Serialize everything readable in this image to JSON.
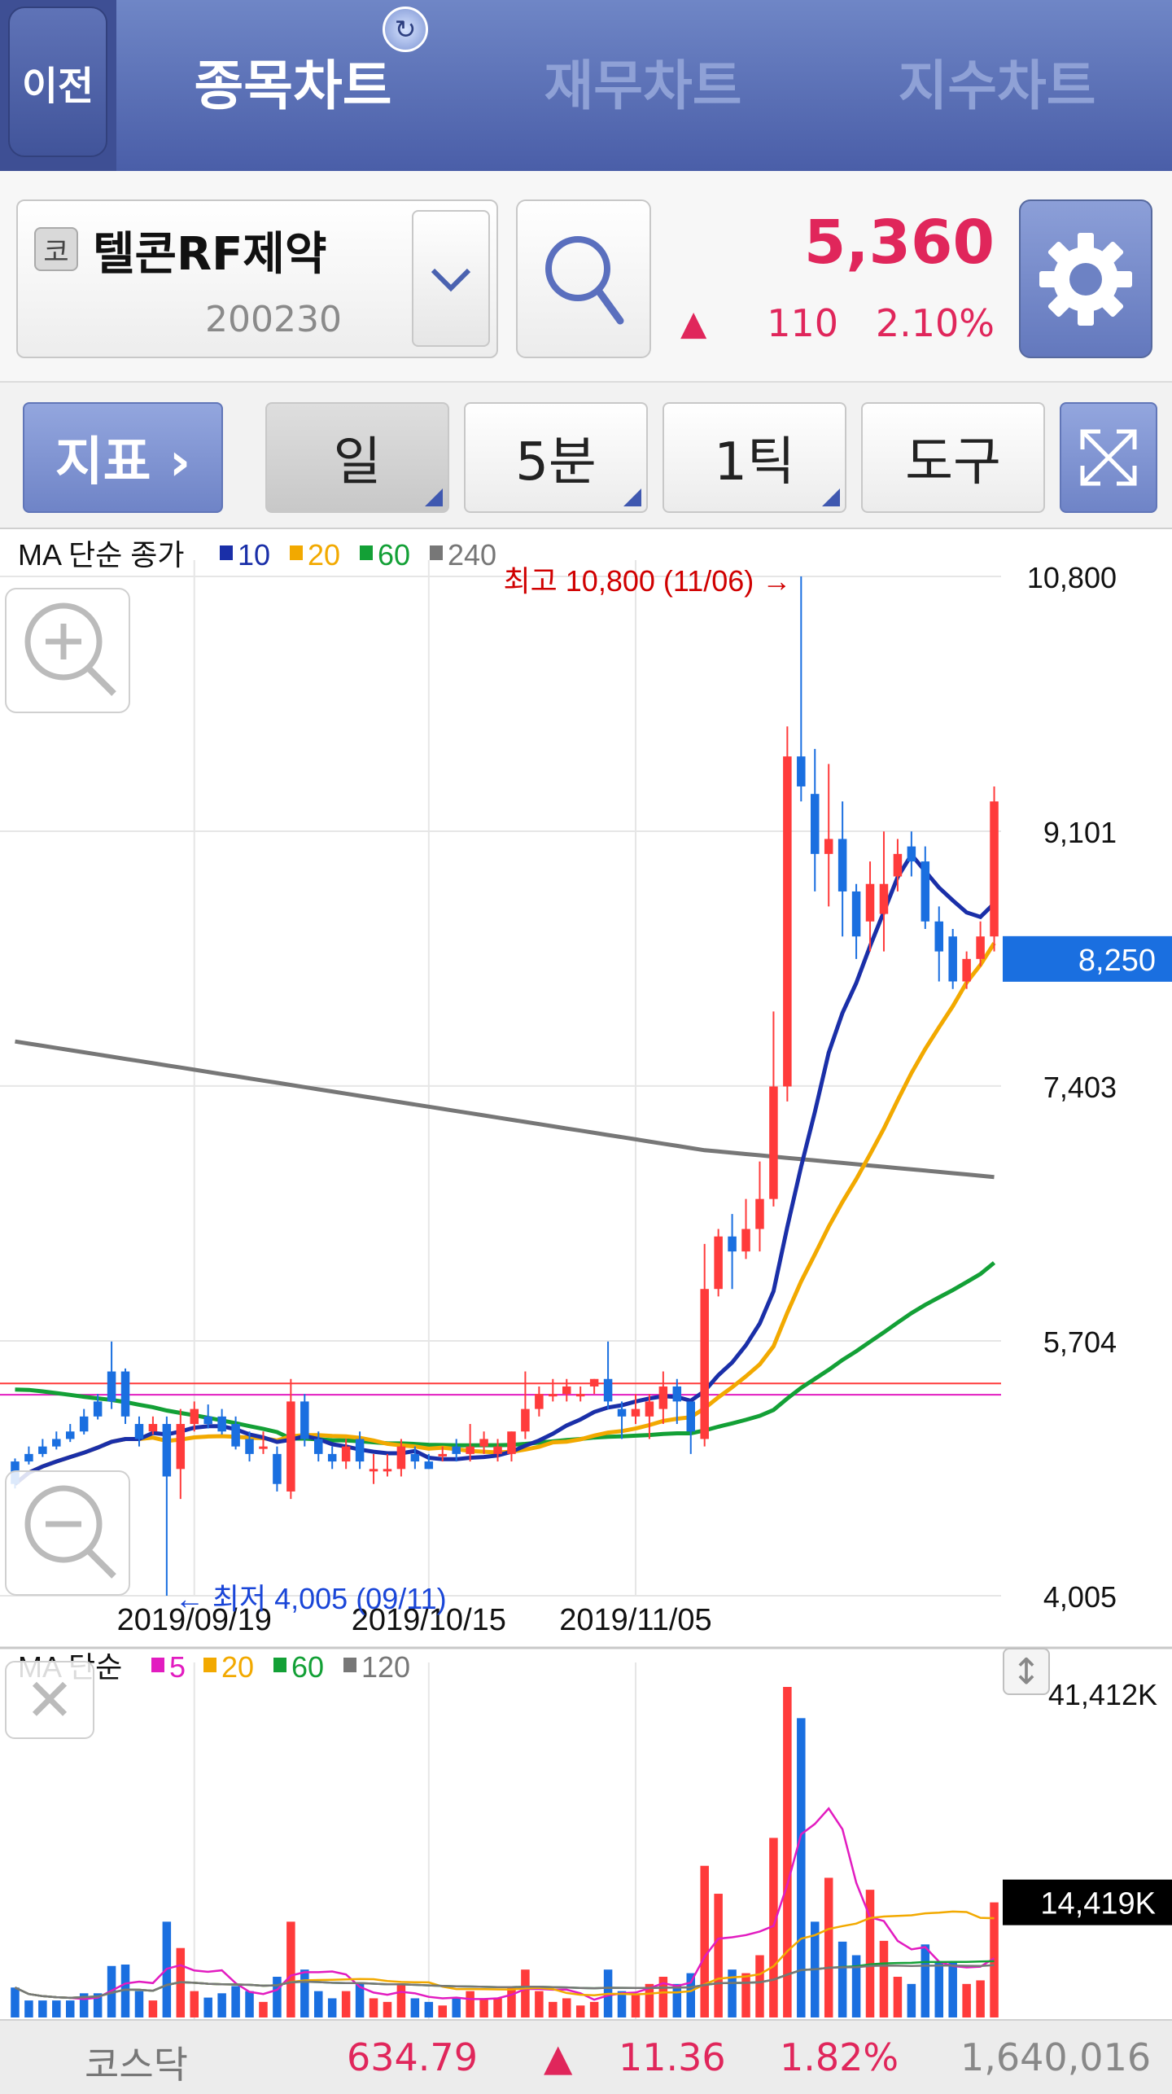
{
  "header": {
    "back_label": "이전",
    "tabs": [
      {
        "label": "종목차트",
        "active": true
      },
      {
        "label": "재무차트",
        "active": false
      },
      {
        "label": "지수차트",
        "active": false
      }
    ]
  },
  "stock": {
    "market_badge": "코",
    "name": "텔콘RF제약",
    "code": "200230",
    "price": "5,360",
    "change_arrow": "▲",
    "change": "110",
    "change_pct": "2.10%"
  },
  "toolbar": {
    "indicator_label": "지표  ›",
    "period_day": "일",
    "period_min": "5분",
    "period_tick": "1틱",
    "tools": "도구"
  },
  "colors": {
    "up": "#ff3b3b",
    "down": "#1a6fe0",
    "ma10": "#1a2fa8",
    "ma20": "#f2a900",
    "ma60": "#13a036",
    "ma240": "#777777",
    "vol_ma5": "#e21cc0",
    "accent": "#e0265b"
  },
  "chart_data": {
    "type": "candlestick",
    "legend": {
      "prefix": "MA 단순 종가",
      "items": [
        {
          "name": "10",
          "color": "#1a2fa8"
        },
        {
          "name": "20",
          "color": "#f2a900"
        },
        {
          "name": "60",
          "color": "#13a036"
        },
        {
          "name": "240",
          "color": "#777777"
        }
      ]
    },
    "y_ticks": [
      "10,800",
      "9,101",
      "7,403",
      "5,704",
      "4,005"
    ],
    "ylim": [
      4005,
      10800
    ],
    "x_ticks": [
      "2019/09/19",
      "2019/10/15",
      "2019/11/05"
    ],
    "current_value": "8,250",
    "high_label": "최고 10,800 (11/06) →",
    "low_label": "← 최저 4,005 (09/11)",
    "candles": [
      [
        4900,
        4750,
        4920,
        4720
      ],
      [
        4950,
        4900,
        5000,
        4880
      ],
      [
        5000,
        4950,
        5050,
        4930
      ],
      [
        5050,
        5000,
        5100,
        4980
      ],
      [
        5100,
        5050,
        5150,
        5030
      ],
      [
        5200,
        5100,
        5250,
        5080
      ],
      [
        5300,
        5200,
        5350,
        5180
      ],
      [
        5500,
        5300,
        5700,
        5250
      ],
      [
        5500,
        5200,
        5520,
        5150
      ],
      [
        5150,
        5050,
        5200,
        5000
      ],
      [
        5100,
        5150,
        5200,
        5080
      ],
      [
        5150,
        4800,
        5200,
        4005
      ],
      [
        4850,
        5150,
        5250,
        4650
      ],
      [
        5150,
        5250,
        5300,
        5100
      ],
      [
        5200,
        5150,
        5280,
        5120
      ],
      [
        5200,
        5100,
        5250,
        5080
      ],
      [
        5150,
        5000,
        5200,
        4980
      ],
      [
        5050,
        4950,
        5100,
        4900
      ],
      [
        5000,
        5000,
        5100,
        4950
      ],
      [
        4950,
        4750,
        5000,
        4700
      ],
      [
        4700,
        5300,
        5450,
        4650
      ],
      [
        5300,
        5050,
        5350,
        5000
      ],
      [
        5050,
        4950,
        5100,
        4900
      ],
      [
        4950,
        4900,
        5000,
        4850
      ],
      [
        4900,
        5000,
        5050,
        4850
      ],
      [
        5050,
        4900,
        5100,
        4850
      ],
      [
        4850,
        4850,
        4950,
        4750
      ],
      [
        4850,
        4850,
        4950,
        4800
      ],
      [
        4850,
        5000,
        5050,
        4800
      ],
      [
        4950,
        4900,
        5000,
        4850
      ],
      [
        4900,
        4850,
        4950,
        4850
      ],
      [
        4950,
        4950,
        5000,
        4900
      ],
      [
        5000,
        4950,
        5050,
        4900
      ],
      [
        4950,
        5000,
        5150,
        4900
      ],
      [
        5000,
        5050,
        5100,
        4950
      ],
      [
        4950,
        5000,
        5050,
        4900
      ],
      [
        4950,
        5100,
        5100,
        4900
      ],
      [
        5100,
        5250,
        5500,
        5050
      ],
      [
        5250,
        5350,
        5400,
        5200
      ],
      [
        5350,
        5350,
        5450,
        5300
      ],
      [
        5350,
        5400,
        5450,
        5300
      ],
      [
        5350,
        5350,
        5400,
        5300
      ],
      [
        5400,
        5450,
        5450,
        5350
      ],
      [
        5450,
        5300,
        5700,
        5250
      ],
      [
        5250,
        5200,
        5300,
        5050
      ],
      [
        5200,
        5250,
        5350,
        5150
      ],
      [
        5200,
        5300,
        5350,
        5050
      ],
      [
        5250,
        5400,
        5500,
        5150
      ],
      [
        5400,
        5300,
        5450,
        5150
      ],
      [
        5300,
        5100,
        5300,
        4950
      ],
      [
        5050,
        6050,
        6350,
        5000
      ],
      [
        6050,
        6400,
        6450,
        6000
      ],
      [
        6400,
        6300,
        6550,
        6050
      ],
      [
        6300,
        6450,
        6650,
        6250
      ],
      [
        6450,
        6650,
        6900,
        6300
      ],
      [
        6650,
        7400,
        7900,
        6600
      ],
      [
        7400,
        9600,
        9800,
        7300
      ],
      [
        9600,
        9400,
        10800,
        9300
      ],
      [
        9350,
        8950,
        9650,
        8700
      ],
      [
        8950,
        9050,
        9550,
        8600
      ],
      [
        9050,
        8700,
        9300,
        8400
      ],
      [
        8700,
        8400,
        8750,
        8250
      ],
      [
        8500,
        8750,
        8900,
        8300
      ],
      [
        8550,
        8750,
        9100,
        8300
      ],
      [
        8800,
        8950,
        9050,
        8700
      ],
      [
        9000,
        8900,
        9100,
        8800
      ],
      [
        8900,
        8500,
        9000,
        8450
      ],
      [
        8500,
        8300,
        8600,
        8100
      ],
      [
        8400,
        8100,
        8450,
        8050
      ],
      [
        8100,
        8250,
        8300,
        8050
      ],
      [
        8250,
        8400,
        8500,
        8200
      ],
      [
        8400,
        9300,
        9400,
        8300
      ]
    ],
    "volume": {
      "legend": {
        "prefix": "MA 단순",
        "items": [
          {
            "name": "5",
            "color": "#e21cc0"
          },
          {
            "name": "20",
            "color": "#f2a900"
          },
          {
            "name": "60",
            "color": "#13a036"
          },
          {
            "name": "120",
            "color": "#777777"
          }
        ]
      },
      "y_ticks": [
        "41,412K"
      ],
      "current_value": "14,419K",
      "unit": "K",
      "max": 41412
    }
  },
  "index_bar": {
    "name": "코스닥",
    "value": "634.79",
    "arrow": "▲",
    "change": "11.36",
    "pct": "1.82%",
    "volume": "1,640,016"
  }
}
